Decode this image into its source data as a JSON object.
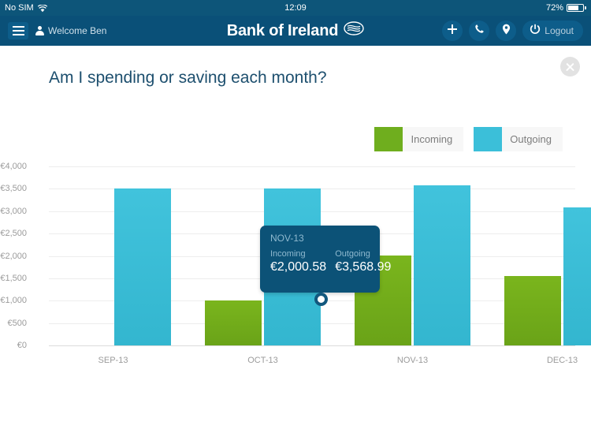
{
  "statusbar": {
    "carrier": "No SIM",
    "wifi_icon": "wifi-icon",
    "time": "12:09",
    "battery_percent": "72%",
    "battery_level": 72
  },
  "navbar": {
    "menu_icon": "hamburger-icon",
    "person_icon": "person-icon",
    "welcome": "Welcome Ben",
    "brand": "Bank of Ireland",
    "brand_mark": "bank-of-ireland-logo",
    "actions": [
      {
        "name": "add-button",
        "icon": "plus-icon"
      },
      {
        "name": "call-button",
        "icon": "phone-icon"
      },
      {
        "name": "locations-button",
        "icon": "map-pin-icon"
      }
    ],
    "logout_label": "Logout",
    "logout_icon": "power-icon"
  },
  "page": {
    "close_icon": "close-icon",
    "headline": "Am I spending or saving each month?"
  },
  "colors": {
    "header_bg": "#0a5078",
    "statusbar_bg": "#0d5579",
    "incoming": "#6fae1e",
    "outgoing": "#3bbfd9",
    "tooltip_bg": "#0c5277",
    "headline": "#1d4f6e",
    "axis_text": "#9b9b9b",
    "gridline": "#ededed",
    "legend_bg": "#f7f7f7"
  },
  "legend": {
    "items": [
      {
        "label": "Incoming",
        "color": "#6fae1e"
      },
      {
        "label": "Outgoing",
        "color": "#3bbfd9"
      }
    ]
  },
  "tooltip": {
    "month": "NOV-13",
    "incoming_label": "Incoming",
    "incoming_value": "€2,000.58",
    "outgoing_label": "Outgoing",
    "outgoing_value": "€3,568.99"
  },
  "chart_data": {
    "type": "bar",
    "title": "Am I spending or saving each month?",
    "xlabel": "",
    "ylabel": "",
    "categories": [
      "SEP-13",
      "OCT-13",
      "NOV-13",
      "DEC-13"
    ],
    "series": [
      {
        "name": "Incoming",
        "color": "#6fae1e",
        "values": [
          0,
          1010,
          2000.58,
          1550
        ]
      },
      {
        "name": "Outgoing",
        "color": "#3bbfd9",
        "values": [
          3500,
          3500,
          3568.99,
          3080
        ]
      }
    ],
    "ylim": [
      0,
      4000
    ],
    "ytick_values": [
      0,
      500,
      1000,
      1500,
      2000,
      2500,
      3000,
      3500,
      4000
    ],
    "ytick_labels": [
      "€0",
      "€500",
      "€1,000",
      "€1,500",
      "€2,000",
      "€2,500",
      "€3,000",
      "€3,500",
      "€4,000"
    ],
    "grid": true,
    "legend_position": "top-right",
    "highlighted_category": "NOV-13",
    "annotations": [
      {
        "category": "NOV-13",
        "series": "Incoming",
        "marker": "circle"
      }
    ]
  }
}
